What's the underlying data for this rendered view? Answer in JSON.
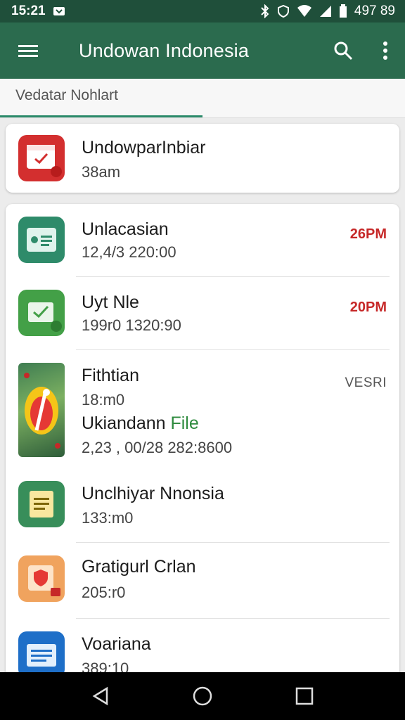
{
  "status_bar": {
    "time": "15:21",
    "battery_text": "497 89"
  },
  "app_bar": {
    "title": "Undowan Indonesia",
    "menu_icon": "hamburger-icon",
    "search_icon": "search-icon",
    "more_icon": "more-vert-icon"
  },
  "tab": {
    "label": "Vedatar Nohlart"
  },
  "top_card": {
    "title": "UndowparInbiar",
    "subtitle": "38am",
    "icon": "calendar-icon"
  },
  "items": [
    {
      "title": "Unlacasian",
      "subtitle": "12,4/3 220:00",
      "time": "26PM",
      "icon": "id-card-icon"
    },
    {
      "title": "Uyt Nle",
      "subtitle": "199r0 1320:90",
      "time": "20PM",
      "icon": "checkbox-app-icon"
    },
    {
      "title": "Fithtian",
      "subtitle": "18:m0",
      "title2": "Ukiandann",
      "title2_green": "File",
      "subtitle2": "2,23 , 00/28 282:8600",
      "tag": "VESRI",
      "icon": "photo-thumbnail-icon"
    },
    {
      "title": "Unclhiyar Nnonsia",
      "subtitle": "133:m0",
      "icon": "notes-icon"
    },
    {
      "title": "Gratigurl Crlan",
      "subtitle": "205:r0",
      "icon": "shield-app-icon"
    },
    {
      "title": "Voariana",
      "subtitle": "389:10",
      "icon": "document-icon"
    }
  ],
  "colors": {
    "status_bar": "#1f4f3a",
    "app_bar": "#2b6b4e",
    "accent_red": "#c62828",
    "tab_indicator": "#2b8a6a"
  }
}
